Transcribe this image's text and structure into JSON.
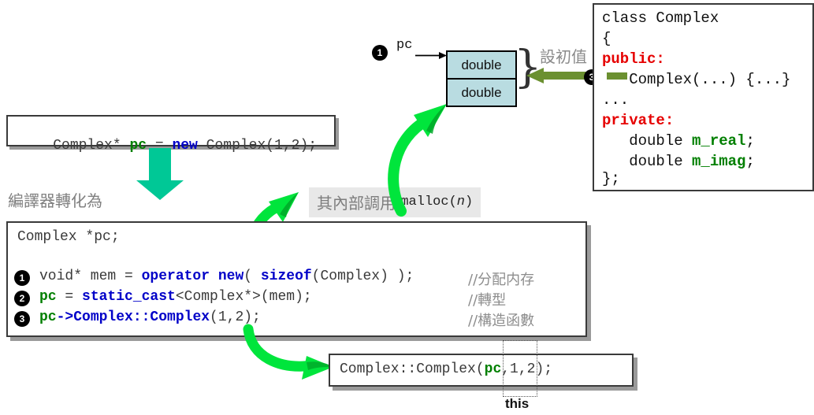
{
  "statement_box": {
    "parts": [
      {
        "text": "Complex* ",
        "style": "plain"
      },
      {
        "text": "pc",
        "style": "green"
      },
      {
        "text": " = ",
        "style": "plain"
      },
      {
        "text": "new",
        "style": "keyword"
      },
      {
        "text": " Complex(1,2);",
        "style": "plain"
      }
    ],
    "full_text": "Complex* pc = new Complex(1,2);"
  },
  "compiler_note": "編譯器轉化為",
  "malloc_note": {
    "zh": "其內部調用 ",
    "code_prefix": "malloc(",
    "code_italic": "n",
    "code_suffix": ")"
  },
  "main_code": {
    "decl": "Complex *pc;",
    "lines": [
      {
        "marker": "1",
        "code": "void* mem = operator new( sizeof(Complex) );",
        "comment": "//分配内存"
      },
      {
        "marker": "2",
        "code": "pc = static_cast<Complex*>(mem);",
        "comment": "//轉型"
      },
      {
        "marker": "3",
        "code": "pc->Complex::Complex(1,2);",
        "comment": "//構造函數"
      }
    ]
  },
  "memory": {
    "pointer_marker": "1",
    "pointer_label": "pc",
    "cells": [
      "double",
      "double"
    ],
    "brace": "}"
  },
  "set_init": {
    "label": "設初值",
    "marker": "3"
  },
  "class_box": {
    "lines": [
      [
        {
          "t": "class Complex",
          "s": "plain"
        }
      ],
      [
        {
          "t": "{",
          "s": "plain"
        }
      ],
      [
        {
          "t": "public:",
          "s": "red"
        }
      ],
      [
        {
          "t": "   Complex(...) {...}",
          "s": "plain"
        }
      ],
      [
        {
          "t": "...",
          "s": "plain"
        }
      ],
      [
        {
          "t": "private:",
          "s": "red"
        }
      ],
      [
        {
          "t": "   double ",
          "s": "plain"
        },
        {
          "t": "m_real",
          "s": "green"
        },
        {
          "t": ";",
          "s": "plain"
        }
      ],
      [
        {
          "t": "   double ",
          "s": "plain"
        },
        {
          "t": "m_imag",
          "s": "green"
        },
        {
          "t": ";",
          "s": "plain"
        }
      ],
      [
        {
          "t": "};",
          "s": "plain"
        }
      ]
    ],
    "marker": "3"
  },
  "bottom_box": {
    "parts": [
      {
        "text": "Complex::Complex(",
        "style": "plain"
      },
      {
        "text": "pc",
        "style": "green"
      },
      {
        "text": ",1,2);",
        "style": "plain"
      }
    ],
    "full_text": "Complex::Complex(pc,1,2);"
  },
  "this_label": "this",
  "colors": {
    "bright_green_arrow": "#00e53c",
    "teal_arrow": "#00c896",
    "olive_arrow": "#6b9030",
    "cell_blue": "#b9dce1",
    "keyword_blue": "#0000c8",
    "identifier_green": "#007f00",
    "access_red": "#e60000",
    "comment_gray": "#8d8d8d"
  }
}
